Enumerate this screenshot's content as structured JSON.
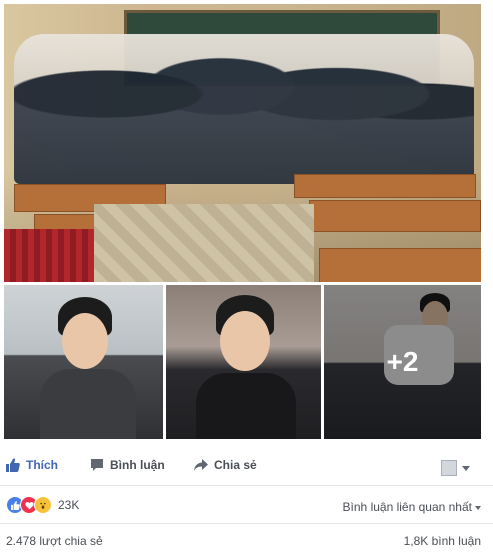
{
  "photos": {
    "more_count": "+2"
  },
  "actions": {
    "like": "Thích",
    "comment": "Bình luận",
    "share": "Chia sẻ"
  },
  "reactions": {
    "count": "23K",
    "sort": "Bình luận liên quan nhất",
    "shares": "2.478 lượt chia sẻ",
    "comments": "1,8K bình luận"
  },
  "colors": {
    "like_blue": "#4267b2",
    "love_red": "#f0304e",
    "wow_yellow": "#f7c23a"
  }
}
